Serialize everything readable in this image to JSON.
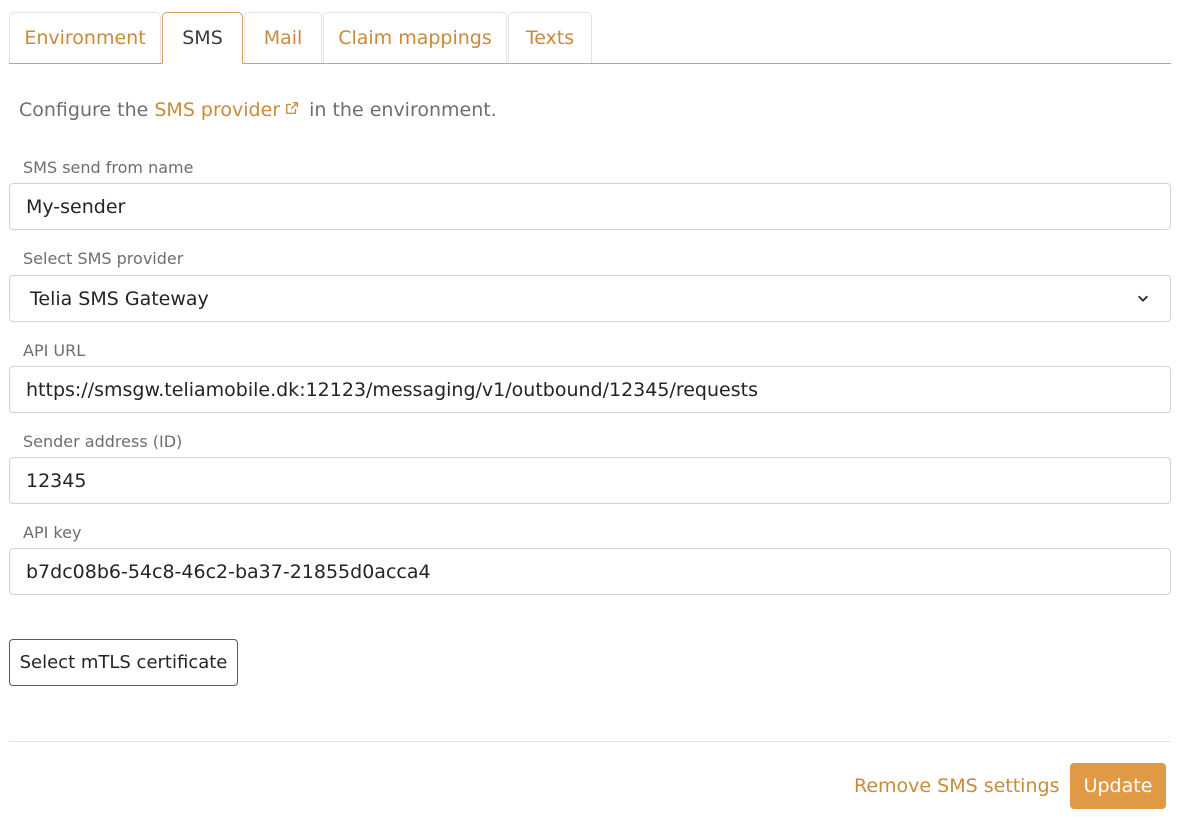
{
  "tabs": [
    {
      "label": "Environment",
      "active": false
    },
    {
      "label": "SMS",
      "active": true
    },
    {
      "label": "Mail",
      "active": false
    },
    {
      "label": "Claim mappings",
      "active": false
    },
    {
      "label": "Texts",
      "active": false
    }
  ],
  "intro": {
    "prefix": "Configure the",
    "link_text": "SMS provider",
    "suffix": "in the environment."
  },
  "fields": {
    "send_from_name": {
      "label": "SMS send from name",
      "value": "My-sender"
    },
    "provider": {
      "label": "Select SMS provider",
      "value": "Telia SMS Gateway"
    },
    "api_url": {
      "label": "API URL",
      "value": "https://smsgw.teliamobile.dk:12123/messaging/v1/outbound/12345/requests"
    },
    "sender_address": {
      "label": "Sender address (ID)",
      "value": "12345"
    },
    "api_key": {
      "label": "API key",
      "value": "b7dc08b6-54c8-46c2-ba37-21855d0acca4"
    }
  },
  "buttons": {
    "select_certificate": "Select mTLS certificate",
    "remove_settings": "Remove SMS settings",
    "update": "Update"
  },
  "colors": {
    "accent": "#c98a3c",
    "primary_button": "#e09a45",
    "tab_border": "#d7a25e"
  },
  "icons": {
    "external_link": "external-link-icon",
    "select_chevron": "chevron-down-icon"
  }
}
